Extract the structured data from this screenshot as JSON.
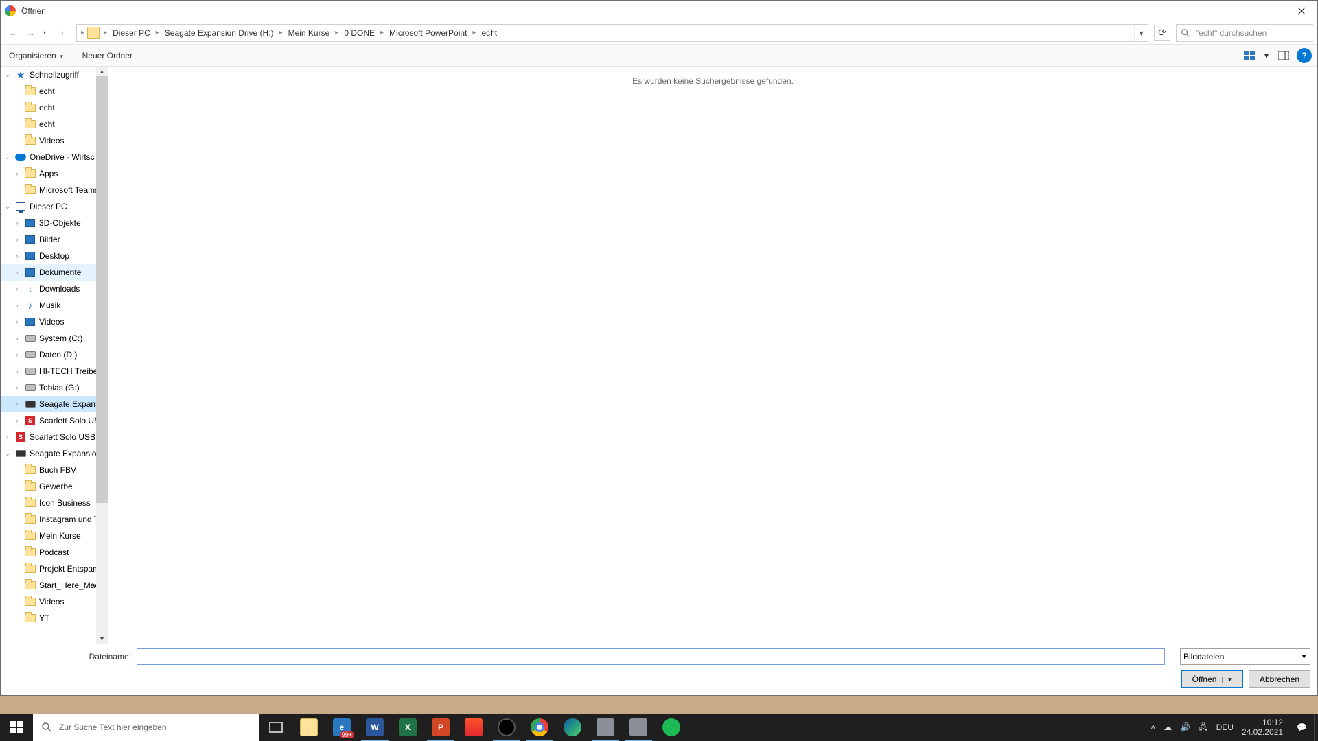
{
  "window": {
    "title": "Öffnen"
  },
  "breadcrumb": [
    "Dieser PC",
    "Seagate Expansion Drive (H:)",
    "Mein Kurse",
    "0 DONE",
    "Microsoft PowerPoint",
    "echt"
  ],
  "search": {
    "placeholder": "\"echt\" durchsuchen"
  },
  "toolbar": {
    "organize": "Organisieren",
    "newfolder": "Neuer Ordner"
  },
  "content": {
    "empty": "Es wurden keine Suchergebnisse gefunden."
  },
  "tree": [
    {
      "d": 0,
      "label": "Schnellzugriff",
      "icon": "star",
      "tw": "v"
    },
    {
      "d": 1,
      "label": "echt",
      "icon": "folder"
    },
    {
      "d": 1,
      "label": "echt",
      "icon": "folder"
    },
    {
      "d": 1,
      "label": "echt",
      "icon": "folder"
    },
    {
      "d": 1,
      "label": "Videos",
      "icon": "folder"
    },
    {
      "d": 0,
      "label": "OneDrive - Wirtsc",
      "icon": "cloud",
      "tw": "v"
    },
    {
      "d": 1,
      "label": "Apps",
      "icon": "folder",
      "tw": ">"
    },
    {
      "d": 1,
      "label": "Microsoft Teams",
      "icon": "folder"
    },
    {
      "d": 0,
      "label": "Dieser PC",
      "icon": "pc",
      "tw": "v"
    },
    {
      "d": 1,
      "label": "3D-Objekte",
      "icon": "blue",
      "tw": ">"
    },
    {
      "d": 1,
      "label": "Bilder",
      "icon": "blue",
      "tw": ">"
    },
    {
      "d": 1,
      "label": "Desktop",
      "icon": "blue",
      "tw": ">"
    },
    {
      "d": 1,
      "label": "Dokumente",
      "icon": "blue",
      "tw": ">",
      "hov": true
    },
    {
      "d": 1,
      "label": "Downloads",
      "icon": "dl",
      "tw": ">"
    },
    {
      "d": 1,
      "label": "Musik",
      "icon": "music",
      "tw": ">"
    },
    {
      "d": 1,
      "label": "Videos",
      "icon": "blue",
      "tw": ">"
    },
    {
      "d": 1,
      "label": "System (C:)",
      "icon": "drive",
      "tw": ">"
    },
    {
      "d": 1,
      "label": "Daten (D:)",
      "icon": "drive",
      "tw": ">"
    },
    {
      "d": 1,
      "label": "HI-TECH Treiber",
      "icon": "drive",
      "tw": ">"
    },
    {
      "d": 1,
      "label": "Tobias (G:)",
      "icon": "drive",
      "tw": ">"
    },
    {
      "d": 1,
      "label": "Seagate Expansi",
      "icon": "darkdrive",
      "tw": ">",
      "sel": true
    },
    {
      "d": 1,
      "label": "Scarlett Solo USB",
      "icon": "red",
      "tw": ">"
    },
    {
      "d": 0,
      "label": "Scarlett Solo USB",
      "icon": "red",
      "tw": ">"
    },
    {
      "d": 0,
      "label": "Seagate Expansion",
      "icon": "darkdrive",
      "tw": "v"
    },
    {
      "d": 1,
      "label": "Buch FBV",
      "icon": "folder"
    },
    {
      "d": 1,
      "label": "Gewerbe",
      "icon": "folder"
    },
    {
      "d": 1,
      "label": "Icon Business",
      "icon": "folder"
    },
    {
      "d": 1,
      "label": "Instagram und T",
      "icon": "folder"
    },
    {
      "d": 1,
      "label": "Mein Kurse",
      "icon": "folder"
    },
    {
      "d": 1,
      "label": "Podcast",
      "icon": "folder"
    },
    {
      "d": 1,
      "label": "Projekt Entspann",
      "icon": "folder"
    },
    {
      "d": 1,
      "label": "Start_Here_Mac.",
      "icon": "folder"
    },
    {
      "d": 1,
      "label": "Videos",
      "icon": "folder"
    },
    {
      "d": 1,
      "label": "YT",
      "icon": "folder"
    }
  ],
  "footer": {
    "filename_label": "Dateiname:",
    "filename_value": "",
    "filetype": "Bilddateien",
    "open": "Öffnen",
    "cancel": "Abbrechen"
  },
  "taskbar": {
    "search_placeholder": "Zur Suche Text hier eingeben",
    "badge": "99+",
    "time": "10:12",
    "date": "24.02.2021",
    "lang": "DEU"
  }
}
